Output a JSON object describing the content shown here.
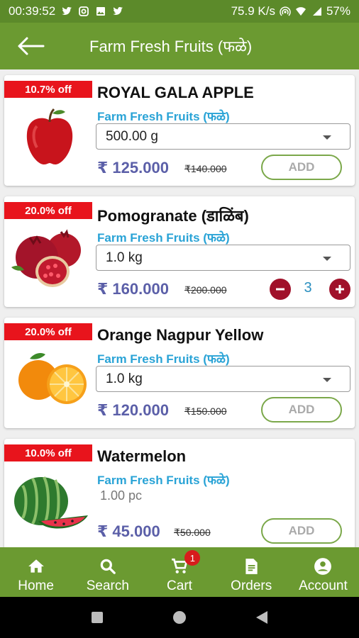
{
  "status_bar": {
    "time": "00:39:52",
    "network_speed": "75.9 K/s",
    "battery": "57%",
    "icons": [
      "twitter-icon",
      "instagram-icon",
      "image-icon",
      "twitter-icon",
      "hotspot-icon",
      "wifi-icon",
      "signal-icon",
      "battery-icon"
    ]
  },
  "app_bar": {
    "title": "Farm Fresh Fruits (फळे)",
    "back_icon": "arrow-left-icon"
  },
  "products": [
    {
      "discount": "10.7% off",
      "name": "ROYAL GALA  APPLE",
      "category": "Farm Fresh Fruits (फळे)",
      "unit": "500.00 g",
      "unit_is_select": true,
      "price": "₹ 125.000",
      "old_price": "₹140.000",
      "action": "ADD",
      "image": "apple"
    },
    {
      "discount": "20.0% off",
      "name": "Pomogranate (डाळिंब)",
      "category": "Farm Fresh Fruits (फळे)",
      "unit": "1.0 kg",
      "unit_is_select": true,
      "price": "₹ 160.000",
      "old_price": "₹200.000",
      "quantity": "3",
      "image": "pomegranate"
    },
    {
      "discount": "20.0% off",
      "name": "Orange Nagpur Yellow",
      "category": "Farm Fresh Fruits (फळे)",
      "unit": "1.0 kg",
      "unit_is_select": true,
      "price": "₹ 120.000",
      "old_price": "₹150.000",
      "action": "ADD",
      "image": "orange"
    },
    {
      "discount": "10.0% off",
      "name": "Watermelon",
      "category": "Farm Fresh Fruits (फळे)",
      "unit": "1.00 pc",
      "unit_is_select": false,
      "price": "₹ 45.000",
      "old_price": "₹50.000",
      "action": "ADD",
      "image": "watermelon"
    }
  ],
  "bottom_nav": {
    "items": [
      {
        "label": "Home",
        "icon": "home-icon"
      },
      {
        "label": "Search",
        "icon": "search-icon"
      },
      {
        "label": "Cart",
        "icon": "cart-icon",
        "badge": "1"
      },
      {
        "label": "Orders",
        "icon": "orders-icon"
      },
      {
        "label": "Account",
        "icon": "account-icon"
      }
    ]
  },
  "colors": {
    "primary_green": "#6b9a31",
    "discount_red": "#e8141c",
    "category_blue": "#29a3d6",
    "price_purple": "#5b5fa8",
    "stepper_maroon": "#a0112a"
  }
}
